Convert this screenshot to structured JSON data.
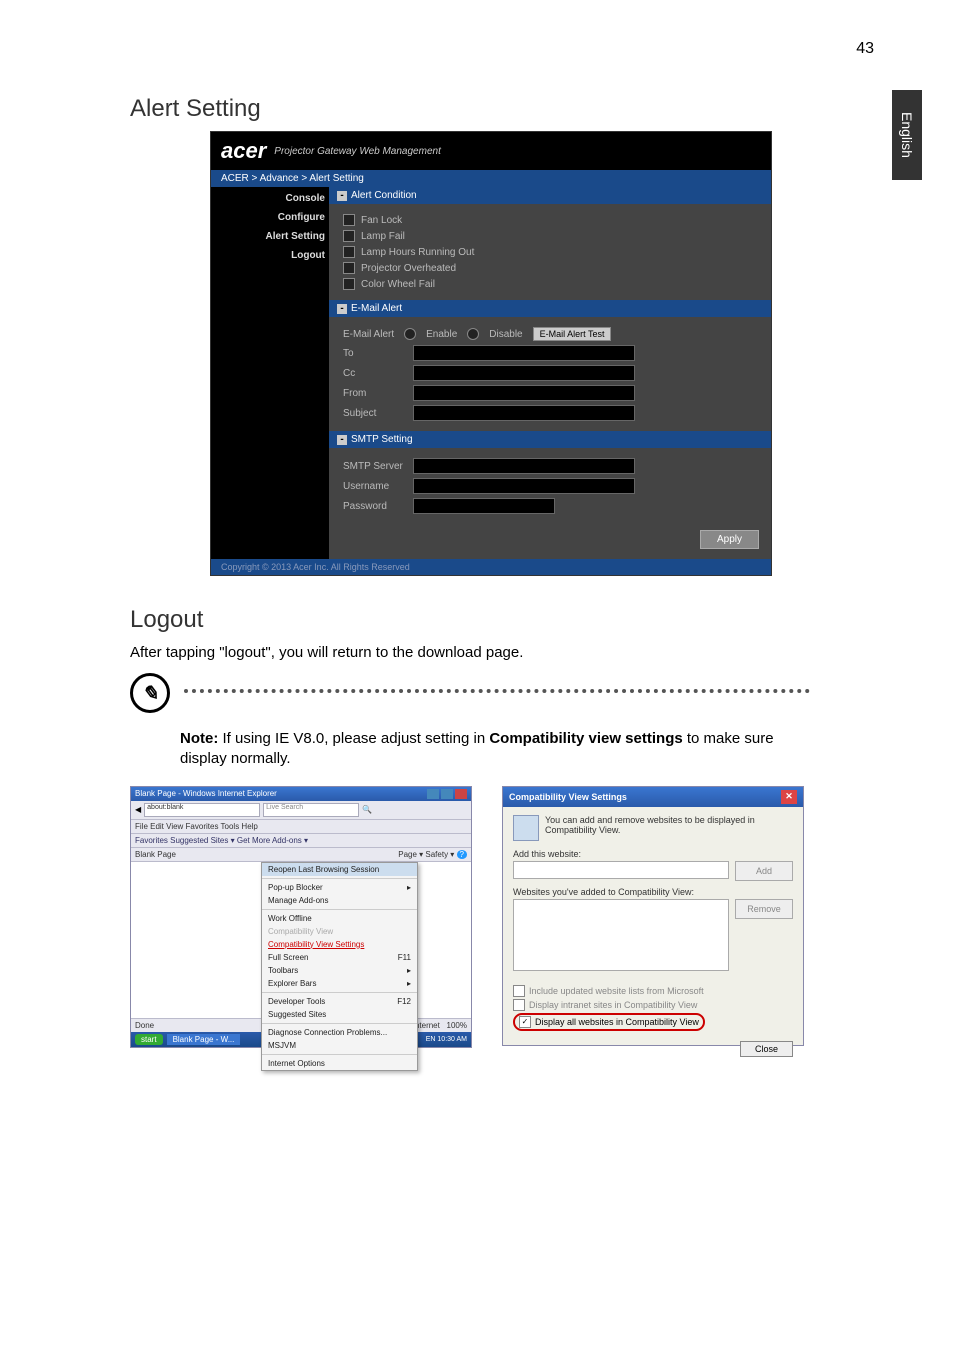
{
  "page_number": "43",
  "side_tab": "English",
  "heading_alert": "Alert Setting",
  "acer": {
    "logo": "acer",
    "subtitle": "Projector Gateway Web Management",
    "breadcrumb": "ACER > Advance > Alert Setting",
    "menu": {
      "console": "Console",
      "configure": "Configure",
      "alert_setting": "Alert Setting",
      "logout": "Logout"
    },
    "group_alert": "Alert Condition",
    "checks": {
      "fan_lock": "Fan Lock",
      "lamp_fail": "Lamp Fail",
      "lamp_hours": "Lamp Hours Running Out",
      "overheat": "Projector Overheated",
      "color_wheel": "Color Wheel Fail"
    },
    "group_email": "E-Mail Alert",
    "email_alert_label": "E-Mail Alert",
    "enable": "Enable",
    "disable": "Disable",
    "test_btn": "E-Mail Alert Test",
    "fields": {
      "to": "To",
      "cc": "Cc",
      "from": "From",
      "subject": "Subject"
    },
    "group_smtp": "SMTP Setting",
    "smtp_fields": {
      "server": "SMTP Server",
      "user": "Username",
      "pass": "Password"
    },
    "apply": "Apply",
    "copyright": "Copyright © 2013 Acer Inc. All Rights Reserved"
  },
  "heading_logout": "Logout",
  "logout_text": "After tapping \"logout\", you will return to the download page.",
  "note": {
    "prefix": "Note:",
    "text1": " If using IE V8.0, please adjust setting in ",
    "bold1": "Compatibility view settings",
    "text2": " to make sure display normally."
  },
  "ie": {
    "title": "Blank Page - Windows Internet Explorer",
    "addr": "about:blank",
    "search_hint": "Live Search",
    "menubar": "File   Edit   View   Favorites   Tools   Help",
    "favbar": "Favorites      Suggested Sites ▾    Get More Add-ons ▾",
    "tab": "Blank Page",
    "toolbar_right": "Page ▾  Safety ▾",
    "help_icon": "?",
    "menu": {
      "reopen": "Reopen Last Browsing Session",
      "popup": "Pop-up Blocker",
      "addons": "Manage Add-ons",
      "offline": "Work Offline",
      "compat_view": "Compatibility View",
      "compat_settings": "Compatibility View Settings",
      "fullscreen": "Full Screen",
      "fullscreen_key": "F11",
      "toolbars": "Toolbars",
      "explorer": "Explorer Bars",
      "devtools": "Developer Tools",
      "devtools_key": "F12",
      "suggested": "Suggested Sites",
      "diagnose": "Diagnose Connection Problems...",
      "MSJVM": "MSJVM",
      "options": "Internet Options"
    },
    "status_done": "Done",
    "status_net": "Internet",
    "status_zoom": "100%",
    "task_start": "start",
    "task_item": "Blank Page - W...",
    "task_time": "EN  10:30 AM"
  },
  "compat": {
    "title": "Compatibility View Settings",
    "desc": "You can add and remove websites to be displayed in Compatibility View.",
    "add_label": "Add this website:",
    "add_btn": "Add",
    "list_label": "Websites you've added to Compatibility View:",
    "remove_btn": "Remove",
    "chk1": "Include updated website lists from Microsoft",
    "chk2": "Display intranet sites in Compatibility View",
    "chk3": "Display all websites in Compatibility View",
    "close": "Close"
  }
}
